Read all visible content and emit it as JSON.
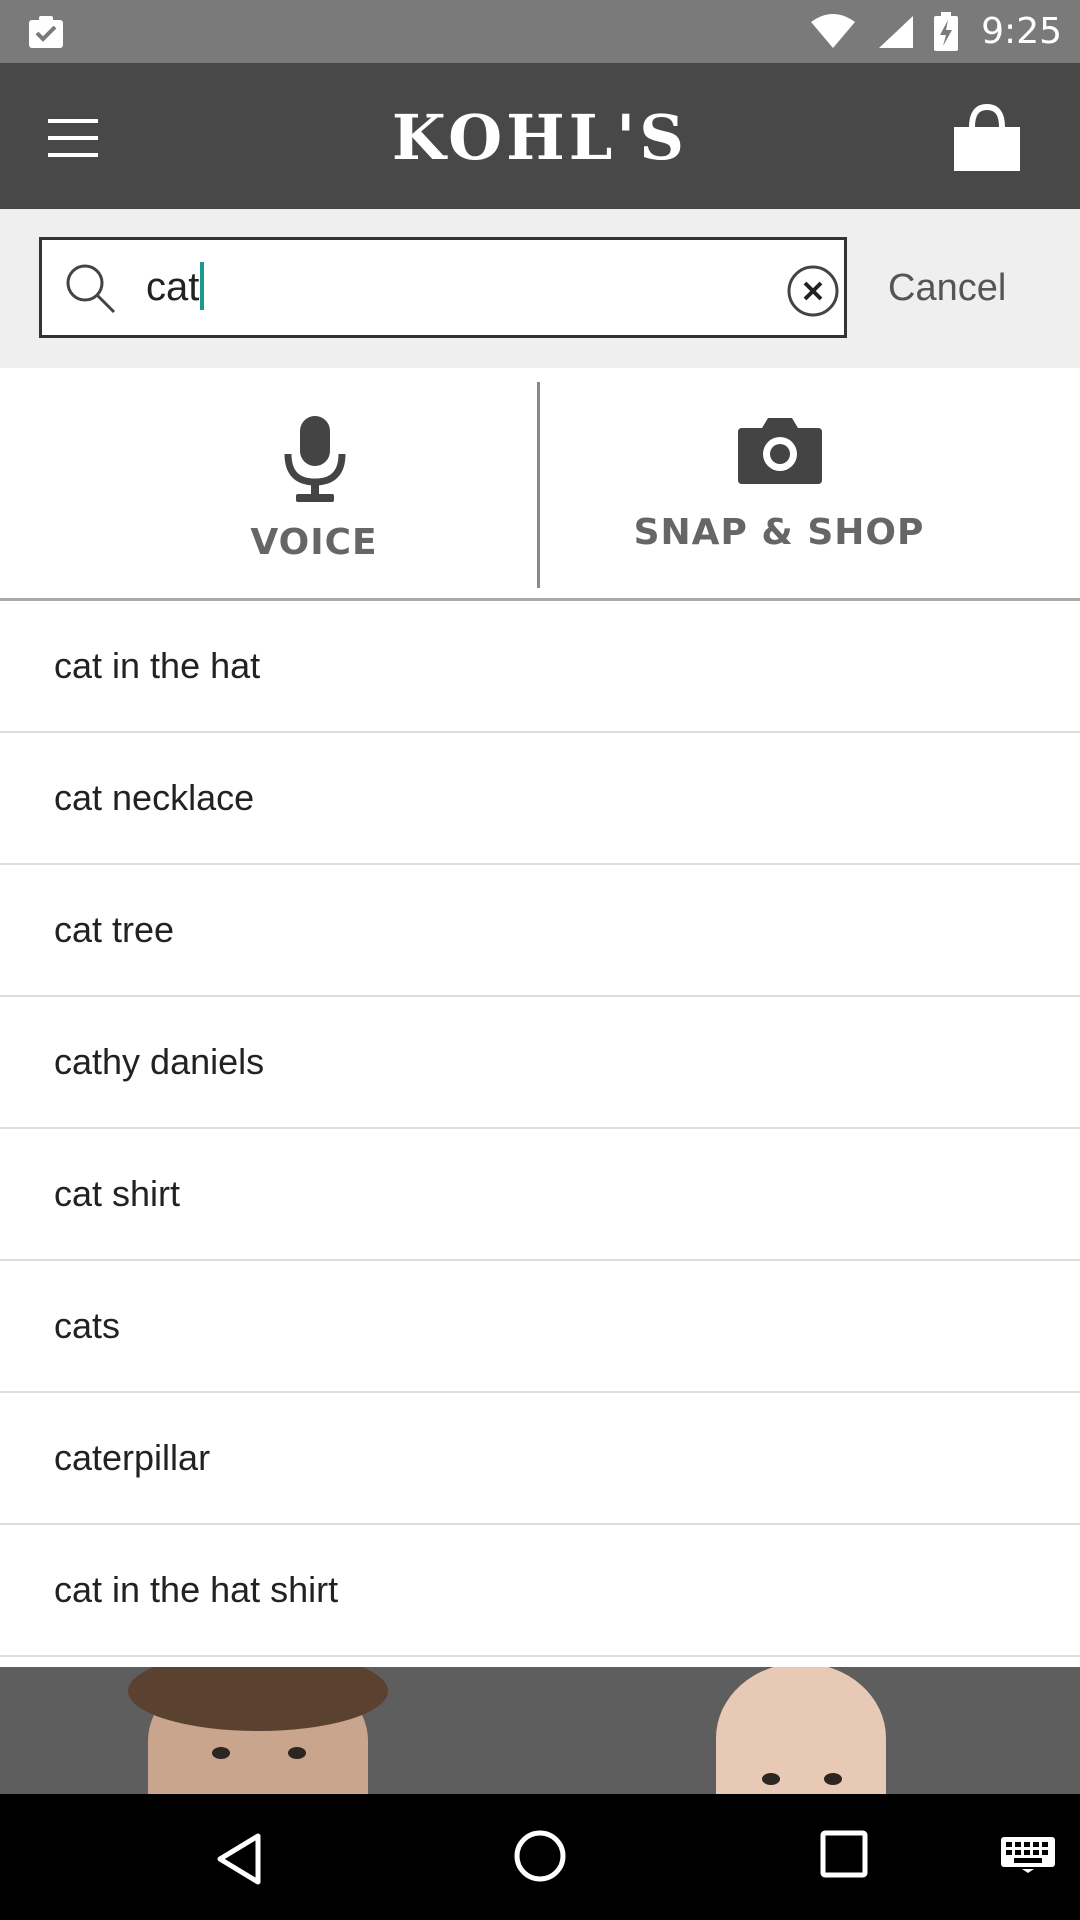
{
  "status_bar": {
    "time": "9:25",
    "left_icon": "clipboard-check-icon",
    "icons": [
      "wifi-icon",
      "signal-icon",
      "battery-charging-icon"
    ]
  },
  "header": {
    "logo_text": "KOHL'S",
    "menu_icon": "hamburger-menu-icon",
    "bag_icon": "shopping-bag-icon"
  },
  "search": {
    "value": "cat",
    "cancel_label": "Cancel",
    "search_icon": "search-icon",
    "clear_icon": "clear-circle-icon"
  },
  "tools": {
    "voice_label": "VOICE",
    "snap_label": "SNAP & SHOP"
  },
  "suggestions": [
    "cat in the hat",
    "cat necklace",
    "cat tree",
    "cathy daniels",
    "cat shirt",
    "cats",
    "caterpillar",
    "cat in the hat shirt"
  ],
  "colors": {
    "header_bg": "#484848",
    "status_bg": "#7a7a7a",
    "caret": "#1a9a8f"
  }
}
